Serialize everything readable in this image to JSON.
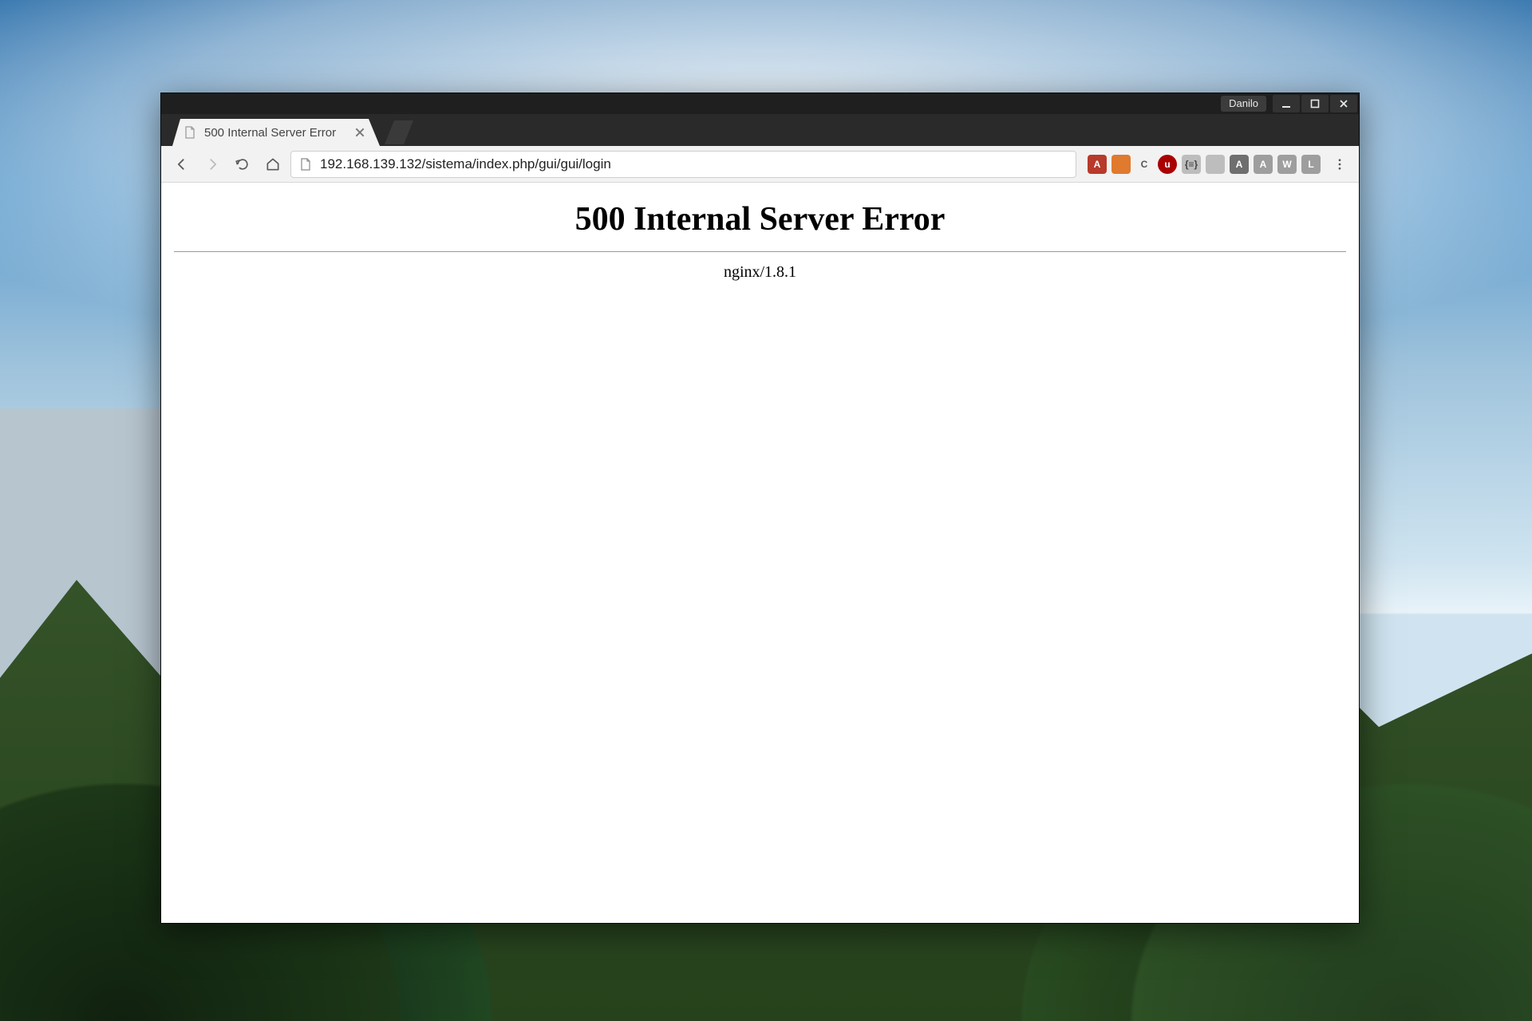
{
  "titlebar": {
    "profile_name": "Danilo"
  },
  "tab": {
    "title": "500 Internal Server Error"
  },
  "toolbar": {
    "url": "192.168.139.132/sistema/index.php/gui/gui/login"
  },
  "extensions": [
    {
      "id": "angular-icon",
      "label": "A",
      "style": "red"
    },
    {
      "id": "brave-icon",
      "label": "",
      "style": "orange"
    },
    {
      "id": "moon-icon",
      "label": "C",
      "style": "gear"
    },
    {
      "id": "ublock-icon",
      "label": "u",
      "style": "ublock"
    },
    {
      "id": "brackets-icon",
      "label": "{≡}",
      "style": "light"
    },
    {
      "id": "server-icon",
      "label": "",
      "style": "light"
    },
    {
      "id": "angular2-icon",
      "label": "A",
      "style": "dark"
    },
    {
      "id": "a-ext-icon",
      "label": "A",
      "style": "text"
    },
    {
      "id": "w-ext-icon",
      "label": "W",
      "style": "text"
    },
    {
      "id": "l-ext-icon",
      "label": "L",
      "style": "text"
    }
  ],
  "page": {
    "heading": "500 Internal Server Error",
    "server_signature": "nginx/1.8.1"
  }
}
